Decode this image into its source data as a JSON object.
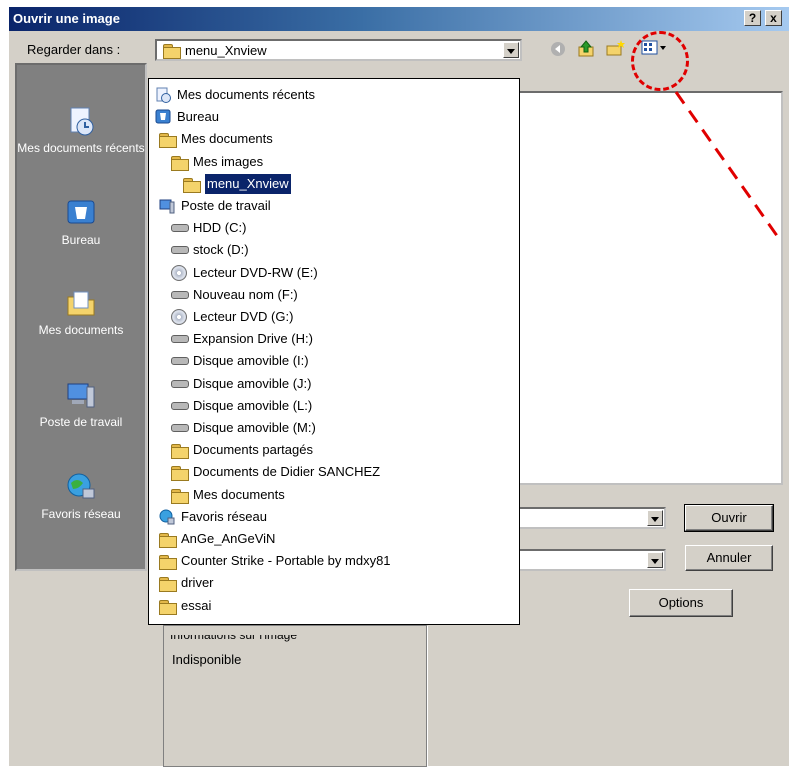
{
  "window": {
    "title": "Ouvrir une image",
    "help_button": "?",
    "close_button": "x"
  },
  "toolbar": {
    "look_in_label": "Regarder dans :",
    "look_in_value": "menu_Xnview"
  },
  "places": [
    {
      "label": "Mes documents récents",
      "icon": "recent-documents-icon"
    },
    {
      "label": "Bureau",
      "icon": "desktop-icon"
    },
    {
      "label": "Mes documents",
      "icon": "my-documents-icon"
    },
    {
      "label": "Poste de travail",
      "icon": "my-computer-icon"
    },
    {
      "label": "Favoris réseau",
      "icon": "network-places-icon"
    }
  ],
  "dropdown": {
    "items": [
      {
        "label": "Mes documents récents",
        "icon": "recent-icon",
        "indent": 0
      },
      {
        "label": "Bureau",
        "icon": "desktop-icon",
        "indent": 0
      },
      {
        "label": "Mes documents",
        "icon": "folder-icon",
        "indent": 1
      },
      {
        "label": "Mes images",
        "icon": "folder-icon",
        "indent": 2
      },
      {
        "label": "menu_Xnview",
        "icon": "folder-icon",
        "indent": 3,
        "selected": true
      },
      {
        "label": "Poste de travail",
        "icon": "computer-icon",
        "indent": 1
      },
      {
        "label": "HDD (C:)",
        "icon": "drive-icon",
        "indent": 2
      },
      {
        "label": "stock (D:)",
        "icon": "drive-icon",
        "indent": 2
      },
      {
        "label": "Lecteur DVD-RW (E:)",
        "icon": "cd-icon",
        "indent": 2
      },
      {
        "label": "Nouveau nom (F:)",
        "icon": "drive-icon",
        "indent": 2
      },
      {
        "label": "Lecteur DVD (G:)",
        "icon": "cd-icon",
        "indent": 2
      },
      {
        "label": "Expansion Drive (H:)",
        "icon": "drive-icon",
        "indent": 2
      },
      {
        "label": "Disque amovible (I:)",
        "icon": "drive-icon",
        "indent": 2
      },
      {
        "label": "Disque amovible (J:)",
        "icon": "drive-icon",
        "indent": 2
      },
      {
        "label": "Disque amovible (L:)",
        "icon": "drive-icon",
        "indent": 2
      },
      {
        "label": "Disque amovible (M:)",
        "icon": "drive-icon",
        "indent": 2
      },
      {
        "label": "Documents partagés",
        "icon": "folder-icon",
        "indent": 2
      },
      {
        "label": "Documents de Didier SANCHEZ",
        "icon": "folder-icon",
        "indent": 2
      },
      {
        "label": "Mes documents",
        "icon": "folder-icon",
        "indent": 2
      },
      {
        "label": "Favoris réseau",
        "icon": "network-icon",
        "indent": 1
      },
      {
        "label": "AnGe_AnGeViN",
        "icon": "folder-icon",
        "indent": 1
      },
      {
        "label": "Counter Strike - Portable by mdxy81",
        "icon": "folder-icon",
        "indent": 1
      },
      {
        "label": "driver",
        "icon": "folder-icon",
        "indent": 1
      },
      {
        "label": "essai",
        "icon": "folder-icon",
        "indent": 1
      }
    ]
  },
  "buttons": {
    "open": "Ouvrir",
    "cancel": "Annuler",
    "options": "Options"
  },
  "info": {
    "title": "Informations sur l'image",
    "value": "Indisponible"
  },
  "colors": {
    "annotation": "#e00000",
    "selection": "#0a246a"
  }
}
